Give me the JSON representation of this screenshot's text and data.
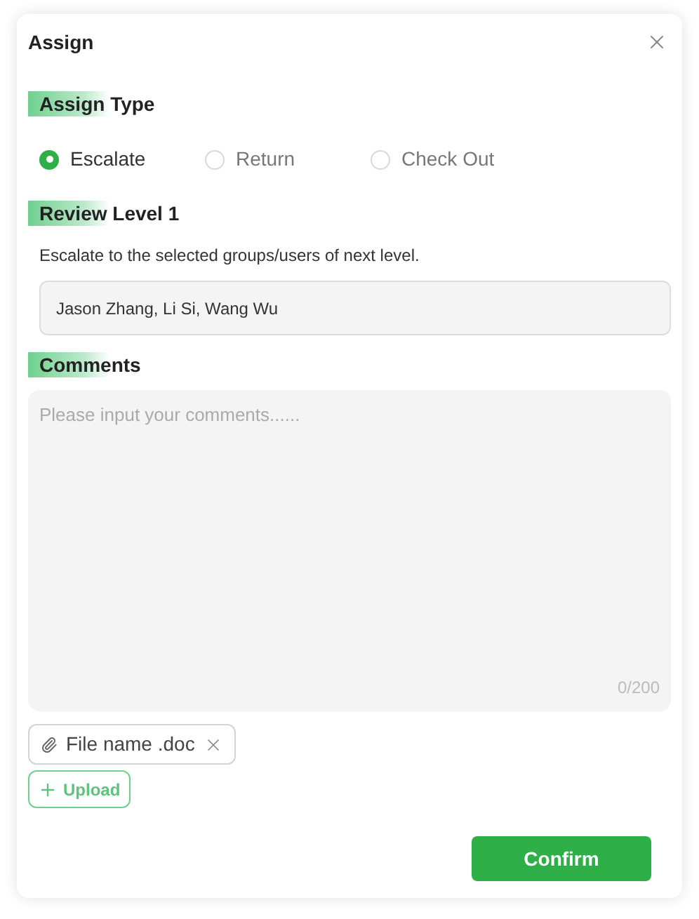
{
  "dialog": {
    "title": "Assign"
  },
  "assign_type": {
    "heading": "Assign Type",
    "options": [
      {
        "label": "Escalate",
        "selected": true
      },
      {
        "label": "Return",
        "selected": false
      },
      {
        "label": "Check Out",
        "selected": false
      }
    ]
  },
  "review_level": {
    "heading": "Review Level 1",
    "description": "Escalate to the selected groups/users of next level.",
    "value": "Jason Zhang, Li Si, Wang Wu"
  },
  "comments": {
    "heading": "Comments",
    "placeholder": "Please input your comments......",
    "counter": "0/200"
  },
  "attachments": [
    {
      "name": "File name .doc"
    }
  ],
  "upload_button": "Upload",
  "confirm_button": "Confirm"
}
